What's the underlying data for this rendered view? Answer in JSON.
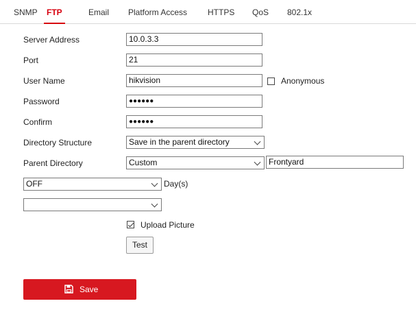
{
  "tabs": [
    {
      "label": "SNMP",
      "active": false
    },
    {
      "label": "FTP",
      "active": true
    },
    {
      "label": "Email",
      "active": false
    },
    {
      "label": "Platform Access",
      "active": false
    },
    {
      "label": "HTTPS",
      "active": false
    },
    {
      "label": "QoS",
      "active": false
    },
    {
      "label": "802.1x",
      "active": false
    }
  ],
  "form": {
    "server_address": {
      "label": "Server Address",
      "value": "10.0.3.3"
    },
    "port": {
      "label": "Port",
      "value": "21"
    },
    "user_name": {
      "label": "User Name",
      "value": "hikvision"
    },
    "anonymous": {
      "label": "Anonymous",
      "checked": false
    },
    "password": {
      "label": "Password",
      "value": "●●●●●●"
    },
    "confirm": {
      "label": "Confirm",
      "value": "●●●●●●"
    },
    "directory_structure": {
      "label": "Directory Structure",
      "selected": "Save in the parent directory"
    },
    "parent_directory": {
      "label": "Parent Directory",
      "selected": "Custom",
      "custom_value": "Frontyard"
    },
    "retention": {
      "selected": "OFF",
      "unit_label": "Day(s)"
    },
    "extra_select": {
      "selected": ""
    },
    "upload_picture": {
      "label": "Upload Picture",
      "checked": true
    },
    "test_label": "Test"
  },
  "save": {
    "label": "Save",
    "icon": "floppy-disk-icon"
  },
  "colors": {
    "accent": "#d7000f",
    "save_button": "#d71820"
  }
}
